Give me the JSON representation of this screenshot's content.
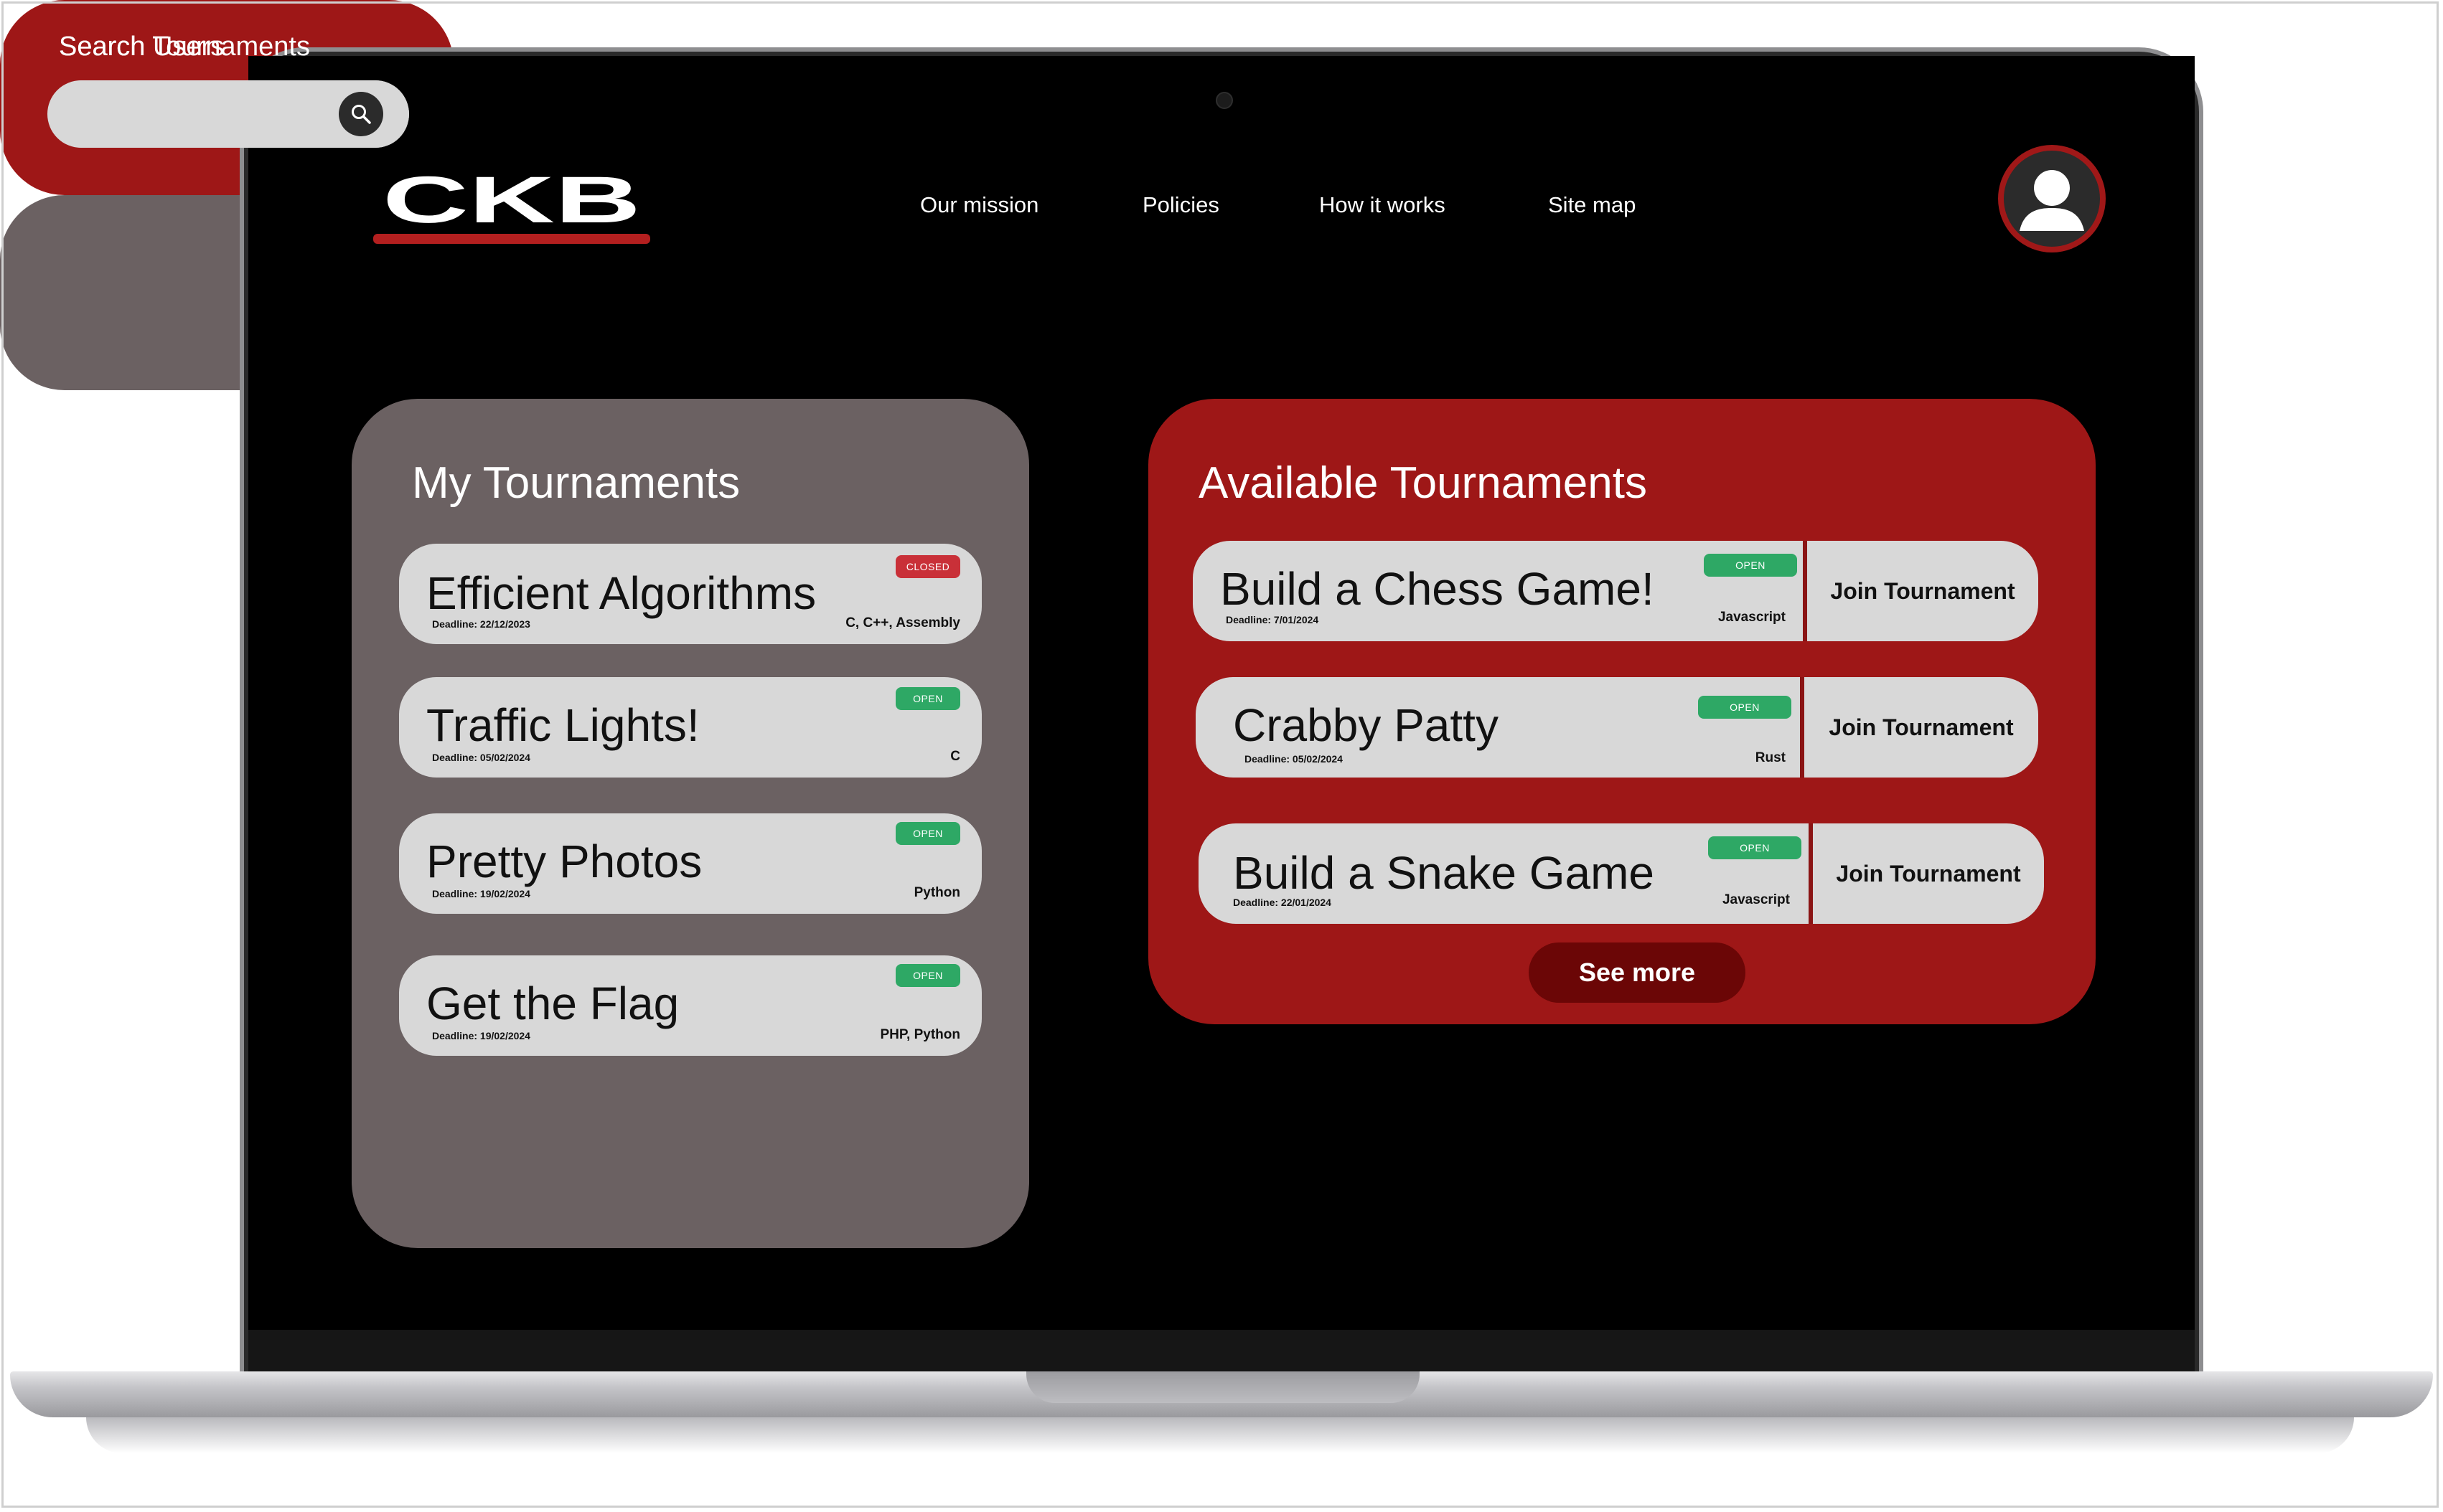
{
  "brand": {
    "logo_text": "CKB",
    "accent": "#9e1717"
  },
  "nav": {
    "items": [
      "Our mission",
      "Policies",
      "How it works",
      "Site map"
    ]
  },
  "my_tournaments": {
    "title": "My Tournaments",
    "items": [
      {
        "name": "Efficient Algorithms",
        "deadline": "Deadline: 22/12/2023",
        "languages": "C, C++, Assembly",
        "status": "CLOSED"
      },
      {
        "name": "Traffic Lights!",
        "deadline": "Deadline: 05/02/2024",
        "languages": "C",
        "status": "OPEN"
      },
      {
        "name": "Pretty Photos",
        "deadline": "Deadline: 19/02/2024",
        "languages": "Python",
        "status": "OPEN"
      },
      {
        "name": "Get the Flag",
        "deadline": "Deadline: 19/02/2024",
        "languages": "PHP, Python",
        "status": "OPEN"
      }
    ]
  },
  "available_tournaments": {
    "title": "Available Tournaments",
    "join_label": "Join Tournament",
    "see_more_label": "See more",
    "items": [
      {
        "name": "Build a Chess Game!",
        "deadline": "Deadline: 7/01/2024",
        "languages": "Javascript",
        "status": "OPEN"
      },
      {
        "name": "Crabby Patty",
        "deadline": "Deadline: 05/02/2024",
        "languages": "Rust",
        "status": "OPEN"
      },
      {
        "name": "Build a Snake Game",
        "deadline": "Deadline: 22/01/2024",
        "languages": "Javascript",
        "status": "OPEN"
      }
    ]
  },
  "search_tournaments": {
    "title": "Search Tournaments",
    "value": "",
    "placeholder": ""
  },
  "search_users": {
    "title": "Search Users",
    "value": "",
    "placeholder": ""
  },
  "colors": {
    "open": "#2ea865",
    "closed": "#c93038",
    "panel_grey": "#6b6162",
    "panel_red": "#9e1717"
  },
  "icons": {
    "profile": "user-avatar-icon",
    "search": "search-icon",
    "filter": "menu-icon"
  }
}
